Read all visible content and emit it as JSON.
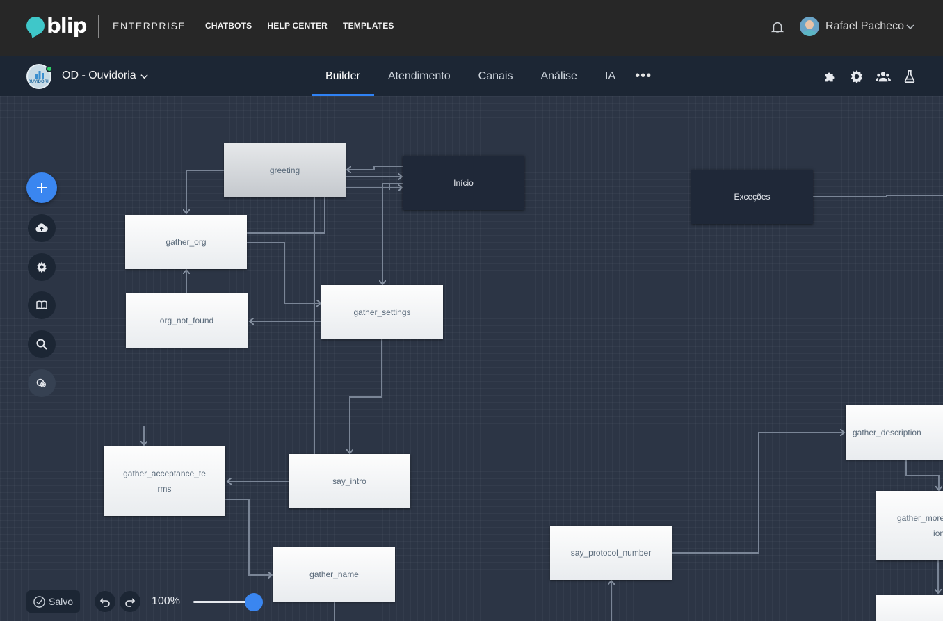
{
  "header": {
    "logo_text": "blip",
    "product": "ENTERPRISE",
    "nav": [
      "CHATBOTS",
      "HELP CENTER",
      "TEMPLATES"
    ],
    "user_name": "Rafael Pacheco"
  },
  "subheader": {
    "bot_name": "OD - Ouvidoria",
    "bot_avatar_text": "OUVIDORIA",
    "tabs": [
      "Builder",
      "Atendimento",
      "Canais",
      "Análise",
      "IA"
    ],
    "active_tab": "Builder",
    "more_label": "•••",
    "icons": [
      "puzzle-icon",
      "gear-icon",
      "users-icon",
      "flask-icon"
    ]
  },
  "flow": {
    "nodes": {
      "greeting": "greeting",
      "inicio": "Início",
      "excecoes": "Exceções",
      "gather_org": "gather_org",
      "org_not_found": "org_not_found",
      "gather_settings": "gather_settings",
      "gather_acceptance_terms": "gather_acceptance_te rms",
      "say_intro": "say_intro",
      "gather_name": "gather_name",
      "say_protocol_number": "say_protocol_number",
      "gather_description": "gather_description",
      "gather_more": "gather_more ion"
    }
  },
  "toolbar": {
    "tools": [
      "add-icon",
      "cloud-upload-icon",
      "gear-icon",
      "book-icon",
      "search-icon",
      "settings-cycle-icon"
    ]
  },
  "footer": {
    "saved_label": "Salvo",
    "zoom_label": "100%",
    "zoom_value": 1.0
  },
  "colors": {
    "accent": "#3a86f0",
    "topbar": "#272727",
    "subbar": "#1c2634",
    "canvas": "#2c3545",
    "online": "#2fd26a"
  }
}
